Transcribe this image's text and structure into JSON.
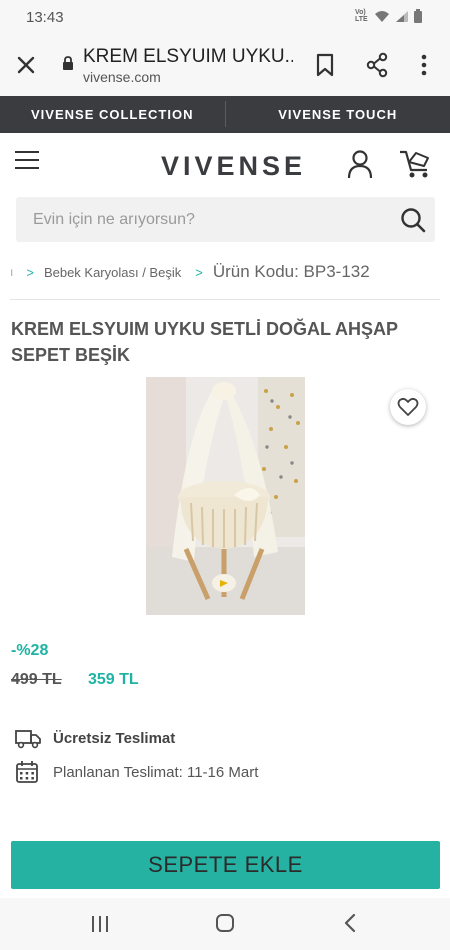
{
  "status_bar": {
    "time": "13:43",
    "network": "VoLTE"
  },
  "browser": {
    "page_title": "KREM ELSYUIM UYKU...",
    "domain": "vivense.com",
    "icons": [
      "close-icon",
      "lock-icon",
      "bookmark-icon",
      "share-icon",
      "more-icon"
    ]
  },
  "collection_bar": {
    "left": "VIVENSE COLLECTION",
    "right": "VIVENSE TOUCH"
  },
  "header": {
    "logo": "VIVENSE",
    "icons": [
      "menu-icon",
      "user-icon",
      "cart-icon"
    ]
  },
  "search": {
    "placeholder": "Evin için ne arıyorsun?"
  },
  "breadcrumb": {
    "separator": ">",
    "category": "Bebek Karyolası / Beşik",
    "product_code": "Ürün Kodu: BP3-132"
  },
  "product": {
    "title": "KREM ELSYUIM UYKU SETLİ DOĞAL AHŞAP SEPET BEŞİK",
    "discount": "-%28",
    "old_price": "499 TL",
    "new_price": "359 TL"
  },
  "delivery": {
    "free_label": "Ücretsiz Teslimat",
    "planned_label": "Planlanan Teslimat: 11-16 Mart"
  },
  "cta": {
    "add_to_cart": "SEPETE EKLE"
  },
  "colors": {
    "accent": "#25b2a2",
    "dark_bar": "#3a3c40"
  }
}
